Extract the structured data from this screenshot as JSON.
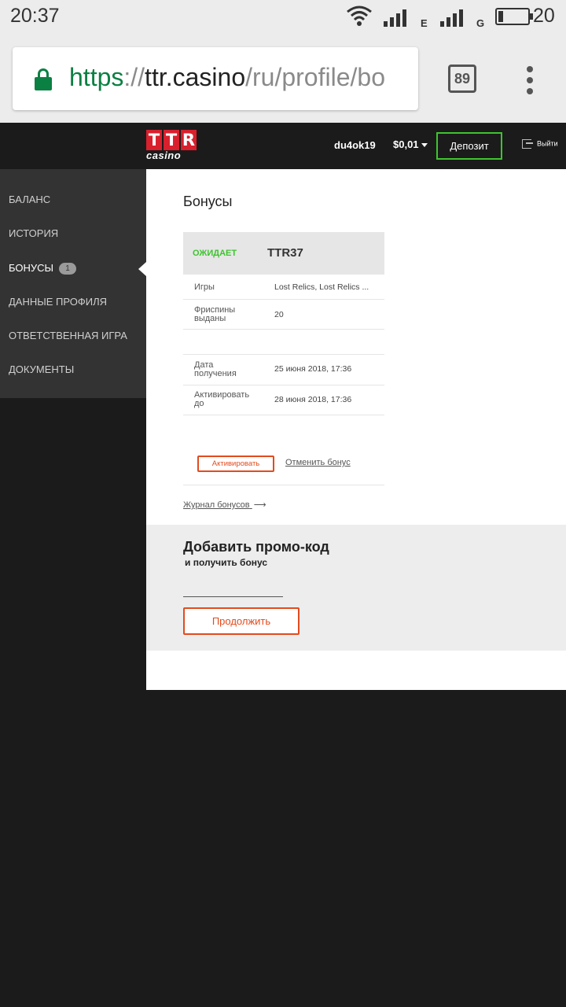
{
  "status_bar": {
    "time": "20:37",
    "network_1": "E",
    "network_2": "G",
    "battery": "20",
    "icons": [
      "wifi-icon",
      "signal-icon",
      "battery-icon"
    ]
  },
  "browser": {
    "url_scheme": "https",
    "url_sep": "://",
    "url_host": "ttr.casino",
    "url_path": "/ru/profile/bo",
    "tab_count": "89"
  },
  "header": {
    "logo_letters": [
      "T",
      "T",
      "R"
    ],
    "logo_sub": "casino",
    "username": "du4ok19",
    "balance": "$0,01",
    "deposit_label": "Депозит",
    "logout_label": "Выйти"
  },
  "sidebar": {
    "items": [
      {
        "label": "БАЛАНС"
      },
      {
        "label": "ИСТОРИЯ"
      },
      {
        "label": "БОНУСЫ",
        "badge": "1",
        "active": true
      },
      {
        "label": "ДАННЫЕ ПРОФИЛЯ"
      },
      {
        "label": "ОТВЕТСТВЕННАЯ ИГРА"
      },
      {
        "label": "ДОКУМЕНТЫ"
      }
    ]
  },
  "main": {
    "title": "Бонусы",
    "bonus": {
      "status": "ОЖИДАЕТ",
      "code": "TTR37",
      "games_label": "Игры",
      "games_value": "Lost Relics, Lost Relics ...",
      "freespins_label_1": "Фриспины",
      "freespins_label_2": "выданы",
      "freespins_value": "20",
      "received_label_1": "Дата",
      "received_label_2": "получения",
      "received_value": "25 июня 2018, 17:36",
      "activate_until_label_1": "Активировать",
      "activate_until_label_2": "до",
      "activate_until_value": "28 июня 2018, 17:36",
      "activate_button": "Активировать",
      "cancel_link": "Отменить бонус"
    },
    "journal_link": "Журнал бонусов",
    "promo": {
      "title": "Добавить промо-код",
      "subtitle": "и получить бонус",
      "input_value": "",
      "continue_button": "Продолжить"
    }
  },
  "colors": {
    "accent_green": "#3ec42f",
    "accent_orange": "#e34b1d",
    "brand_red": "#d9202d",
    "dark_bg": "#1b1b1b",
    "sidebar_bg": "#333333"
  }
}
